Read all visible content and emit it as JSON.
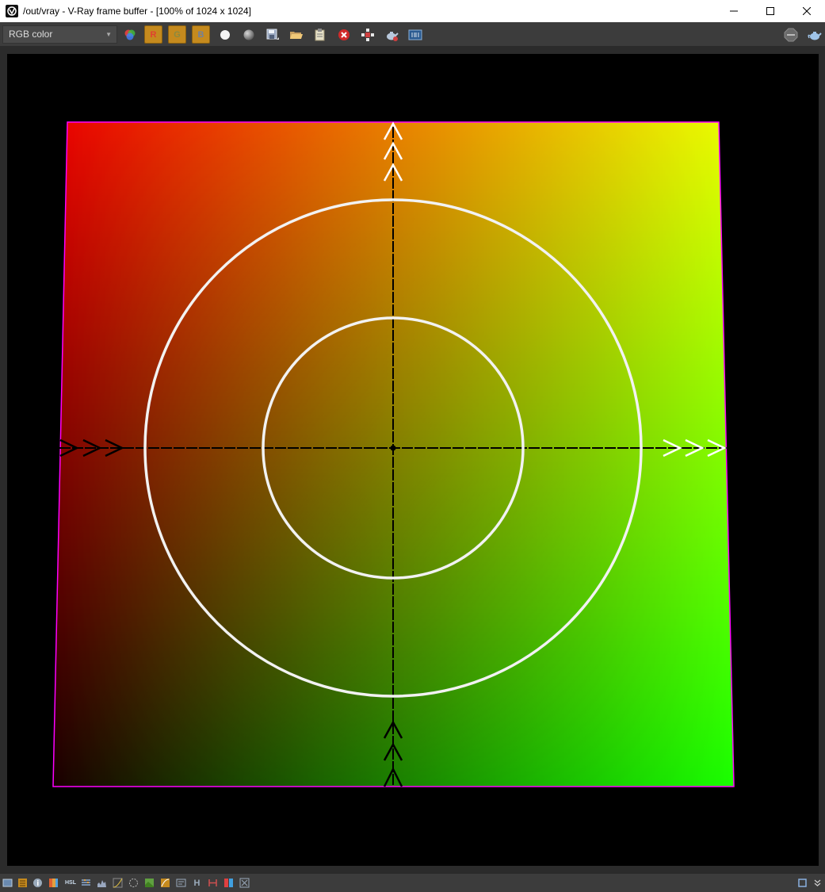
{
  "window": {
    "title": "/out/vray - V-Ray frame buffer - [100% of 1024 x 1024]"
  },
  "toolbar": {
    "channel_value": "RGB color",
    "red_label": "R",
    "green_label": "G",
    "blue_label": "B",
    "icons": [
      "color-channels-icon",
      "red-channel-button",
      "green-channel-button",
      "blue-channel-button",
      "white-circle-icon",
      "gray-sphere-icon",
      "save-icon",
      "open-folder-icon",
      "clipboard-icon",
      "clear-icon",
      "region-render-icon",
      "render-teapot-icon",
      "film-strip-icon",
      "stop-icon",
      "teapot-icon"
    ]
  },
  "colors": {
    "chrome": "#3c3c3c",
    "accent_orange": "#c58a1e",
    "viewport_bg": "#000000",
    "quad_top_left": "#ff0000",
    "quad_top_right": "#ffff00",
    "quad_bottom_left": "#000000",
    "quad_bottom_right": "#00ff00",
    "quad_border": "#ff00ff"
  },
  "statusbar": {
    "icons": [
      "window-icon",
      "layers-icon",
      "info-icon",
      "color-correction-icon",
      "hsl-icon",
      "levels-icon",
      "histogram-icon",
      "curves-icon",
      "exposure-icon",
      "background-image-icon",
      "lut-icon",
      "ocio-icon",
      "h-icon",
      "icc-icon",
      "compare-icon",
      "settings-icon",
      "restore-icon",
      "expand-icon"
    ],
    "hsl_label": "HSL",
    "h_label": "H"
  }
}
